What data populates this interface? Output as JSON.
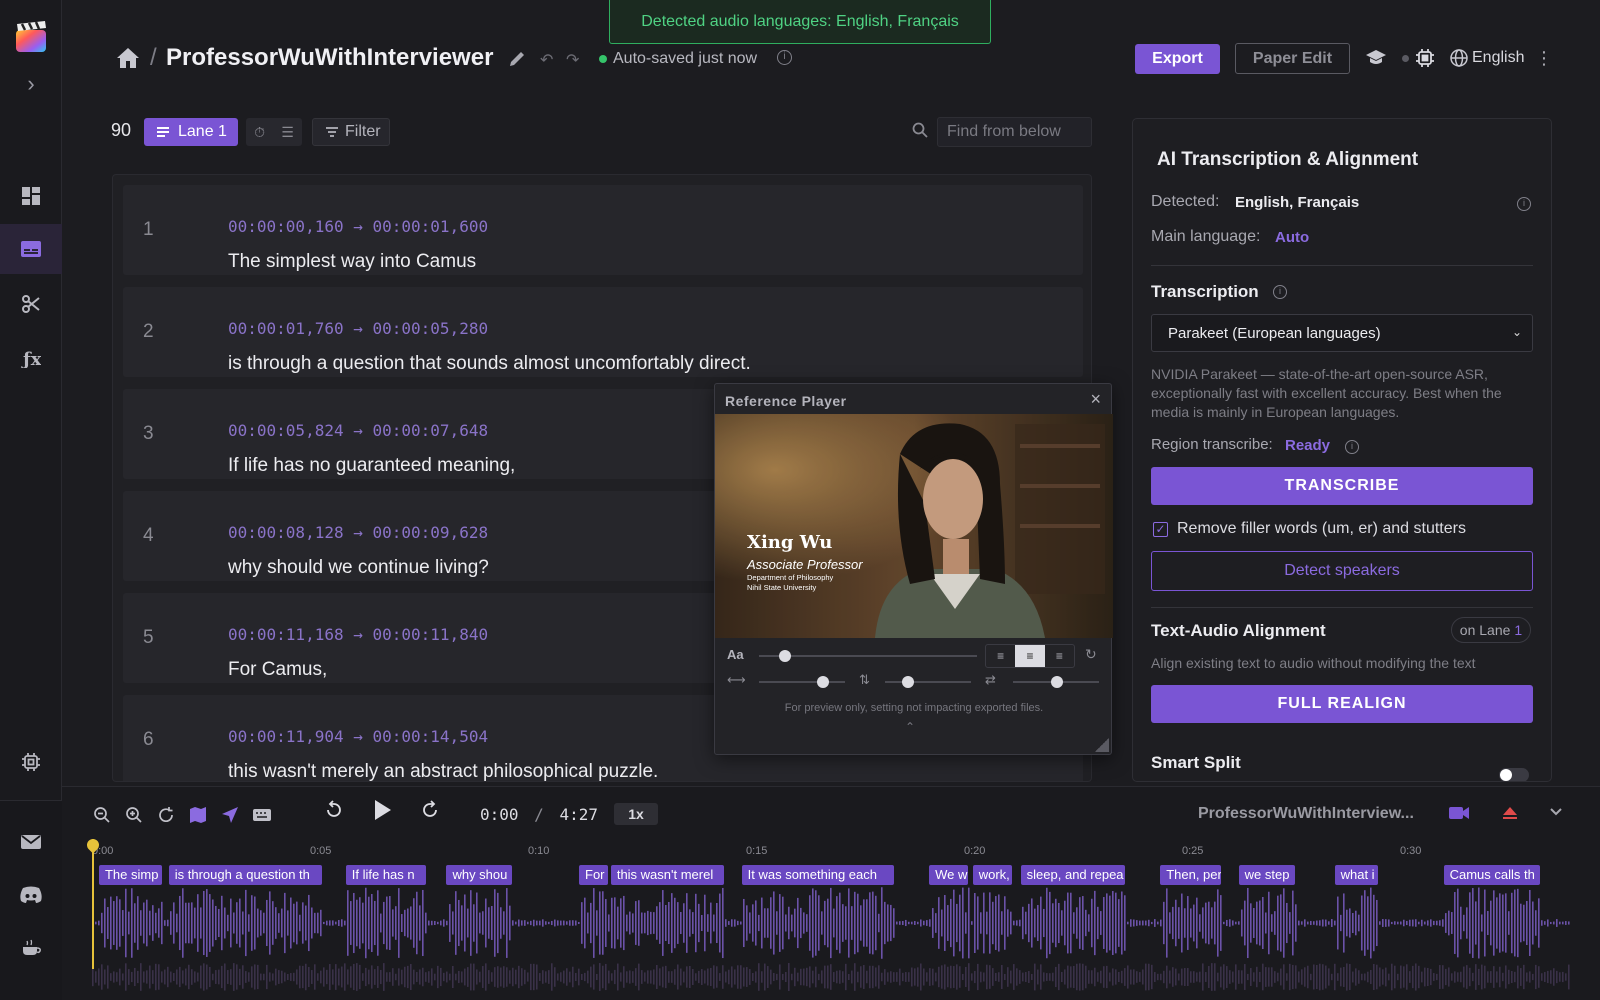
{
  "toast": "Detected audio languages: English, Français",
  "header": {
    "separator": "/",
    "title": "ProfessorWuWithInterviewer",
    "saved_status": "Auto-saved just now",
    "export_label": "Export",
    "paper_edit_label": "Paper Edit",
    "language": "English"
  },
  "toolbar": {
    "count": "90",
    "lane_label": "Lane 1",
    "filter_label": "Filter",
    "find_placeholder": "Find from below"
  },
  "subtitles": [
    {
      "num": "1",
      "timecode": "00:00:00,160 → 00:00:01,600",
      "text": "The simplest way into Camus"
    },
    {
      "num": "2",
      "timecode": "00:00:01,760 → 00:00:05,280",
      "text": "is through a question that sounds almost uncomfortably direct."
    },
    {
      "num": "3",
      "timecode": "00:00:05,824 → 00:00:07,648",
      "text": "If life has no guaranteed meaning,"
    },
    {
      "num": "4",
      "timecode": "00:00:08,128 → 00:00:09,628",
      "text": "why should we continue living?"
    },
    {
      "num": "5",
      "timecode": "00:00:11,168 → 00:00:11,840",
      "text": "For Camus,"
    },
    {
      "num": "6",
      "timecode": "00:00:11,904 → 00:00:14,504",
      "text": "this wasn't merely an abstract philosophical puzzle."
    }
  ],
  "player": {
    "title": "Reference Player",
    "font_label": "Aa",
    "note": "For preview only, setting not impacting exported files.",
    "lower_third": {
      "name": "Xing Wu",
      "role": "Associate Professor",
      "dept": "Department of Philosophy",
      "univ": "Nihil State University"
    }
  },
  "panel": {
    "title": "AI Transcription & Alignment",
    "detected_label": "Detected:",
    "detected_value": "English, Français",
    "main_lang_label": "Main language:",
    "main_lang_value": "Auto",
    "transcription_heading": "Transcription",
    "model_selected": "Parakeet (European languages)",
    "model_desc": "NVIDIA Parakeet — state-of-the-art open-source ASR, exceptionally fast with excellent accuracy. Best when the media is mainly in European languages.",
    "region_label": "Region transcribe:",
    "region_value": "Ready",
    "transcribe_btn": "TRANSCRIBE",
    "filler_label": "Remove filler words (um, er) and stutters",
    "filler_checked": true,
    "detect_speakers_btn": "Detect speakers",
    "alignment_heading": "Text-Audio Alignment",
    "lane_pill_prefix": "on Lane",
    "lane_pill_num": "1",
    "alignment_desc": "Align existing text to audio without modifying the text",
    "realign_btn": "FULL REALIGN",
    "smart_split_heading": "Smart Split",
    "smart_split_on": false
  },
  "timeline": {
    "current_time": "0:00",
    "separator": "/",
    "duration": "4:27",
    "speed": "1x",
    "project_name": "ProfessorWuWithInterview...",
    "ticks": [
      "0:00",
      "0:05",
      "0:10",
      "0:15",
      "0:20",
      "0:25",
      "0:30"
    ],
    "clips": [
      {
        "text": "The simp",
        "start": 0.16,
        "end": 1.6
      },
      {
        "text": "is through a question th",
        "start": 1.76,
        "end": 5.28
      },
      {
        "text": "If life has n",
        "start": 5.82,
        "end": 7.65
      },
      {
        "text": "why shou",
        "start": 8.13,
        "end": 9.63
      },
      {
        "text": "For",
        "start": 11.17,
        "end": 11.84
      },
      {
        "text": "this wasn't merel",
        "start": 11.9,
        "end": 14.5
      },
      {
        "text": "It was something each",
        "start": 14.9,
        "end": 18.4
      },
      {
        "text": "We w",
        "start": 19.2,
        "end": 20.1
      },
      {
        "text": "work,",
        "start": 20.2,
        "end": 21.1
      },
      {
        "text": "sleep, and repea",
        "start": 21.3,
        "end": 23.7
      },
      {
        "text": "Then, per",
        "start": 24.5,
        "end": 25.9
      },
      {
        "text": "we step",
        "start": 26.3,
        "end": 27.6
      },
      {
        "text": "what i",
        "start": 28.5,
        "end": 29.5
      },
      {
        "text": "Camus calls th",
        "start": 31.0,
        "end": 33.2
      }
    ]
  },
  "colors": {
    "accent": "#7a55d4",
    "success": "#35c46a",
    "background": "#1c1c20"
  }
}
